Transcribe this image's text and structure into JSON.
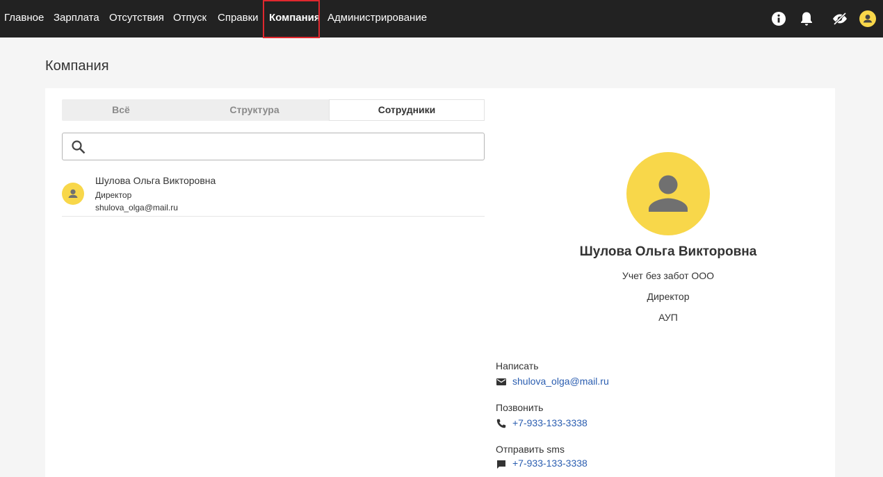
{
  "nav": {
    "items": [
      {
        "label": "Главное"
      },
      {
        "label": "Зарплата"
      },
      {
        "label": "Отсутствия"
      },
      {
        "label": "Отпуск"
      },
      {
        "label": "Справки"
      },
      {
        "label": "Компания"
      },
      {
        "label": "Администрирование"
      }
    ],
    "active": "Компания",
    "icons": [
      "info-icon",
      "bell-icon",
      "visibility-off-icon",
      "user-avatar-icon"
    ]
  },
  "page": {
    "title": "Компания"
  },
  "tabs": [
    {
      "label": "Всё"
    },
    {
      "label": "Структура"
    },
    {
      "label": "Сотрудники"
    }
  ],
  "selected_tab": "Сотрудники",
  "search": {
    "placeholder": "",
    "value": ""
  },
  "employees": [
    {
      "name": "Шулова Ольга Викторовна",
      "position": "Директор",
      "email": "shulova_olga@mail.ru"
    }
  ],
  "profile": {
    "name": "Шулова Ольга Викторовна",
    "company": "Учет без забот ООО",
    "position": "Директор",
    "department": "АУП",
    "contacts": [
      {
        "label": "Написать",
        "icon": "mail-icon",
        "value": "shulova_olga@mail.ru"
      },
      {
        "label": "Позвонить",
        "icon": "phone-icon",
        "value": "+7-933-133-3338"
      },
      {
        "label": "Отправить sms",
        "icon": "sms-icon",
        "value": "+7-933-133-3338"
      }
    ]
  },
  "colors": {
    "topbar": "#222222",
    "avatar": "#f8d74a",
    "avatar_figure": "#707070",
    "link": "#2a5db0",
    "highlight": "#e0282e"
  }
}
